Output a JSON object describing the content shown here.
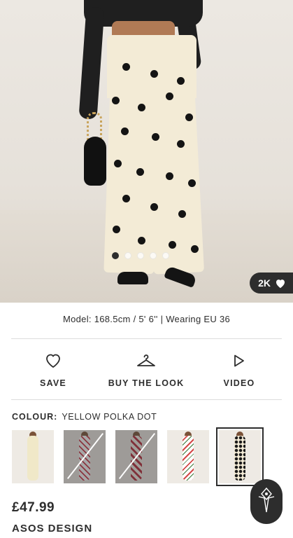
{
  "hero": {
    "image_alt": "Model wearing yellow polka dot wide leg trousers",
    "carousel_count": 5,
    "carousel_active": 0,
    "likes": "2K",
    "heart_icon": "heart-icon"
  },
  "model_info": "Model: 168.5cm / 5' 6'' | Wearing EU 36",
  "actions": [
    {
      "label": "SAVE",
      "icon": "heart-outline-icon"
    },
    {
      "label": "BUY THE LOOK",
      "icon": "hanger-icon"
    },
    {
      "label": "VIDEO",
      "icon": "play-icon"
    }
  ],
  "colour": {
    "key": "COLOUR:",
    "value": "YELLOW POLKA DOT"
  },
  "swatches": [
    {
      "name": "yellow",
      "out_of_stock": false,
      "selected": false
    },
    {
      "name": "white-print",
      "out_of_stock": true,
      "selected": false
    },
    {
      "name": "red-print",
      "out_of_stock": true,
      "selected": false
    },
    {
      "name": "floral",
      "out_of_stock": false,
      "selected": false
    },
    {
      "name": "yellow-polka-dot",
      "out_of_stock": false,
      "selected": true
    }
  ],
  "price": "£47.99",
  "brand": "ASOS DESIGN",
  "colors": {
    "text": "#2d2d2d",
    "divider": "#dddddd",
    "pill": "#2d2d2d"
  }
}
